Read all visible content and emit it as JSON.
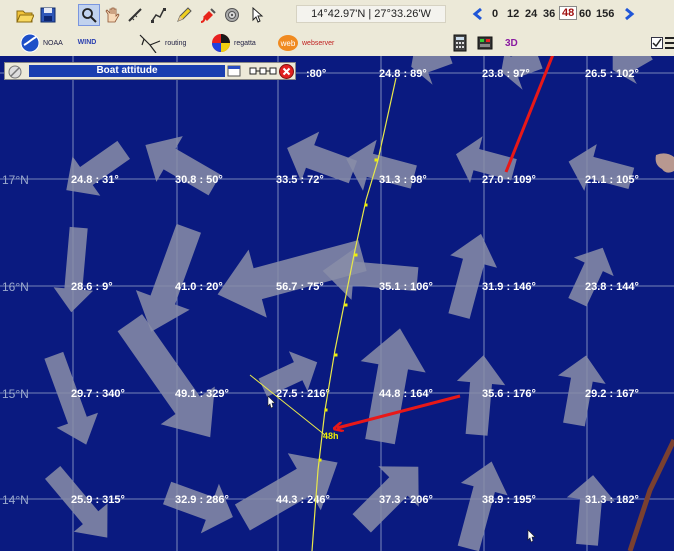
{
  "toolbar": {
    "coords": "14°42.97'N | 27°33.26'W",
    "hours": [
      "0",
      "12",
      "24",
      "36",
      "48",
      "60",
      "156"
    ],
    "selected_hour": "48",
    "icons": [
      "open-folder-icon",
      "save-disk-icon",
      "zoom-icon",
      "pan-hand-icon",
      "measure-icon",
      "route-icon",
      "pencil-icon",
      "paint-icon",
      "target-icon",
      "pointer-icon"
    ]
  },
  "toolbar2": {
    "noaa": "NOAA",
    "wind": "WIND",
    "routing": "routing",
    "regatta": "regatta",
    "webserver": "webserver",
    "three_d": "3D"
  },
  "panel": {
    "title": "Boat attitude"
  },
  "map": {
    "lat_labels": [
      "17°N",
      "16°N",
      "15°N",
      "14°N"
    ],
    "wind_labels": [
      [
        "",
        ":80°",
        "24.8 : 89°",
        "23.8 : 97°",
        "26.5 : 102°"
      ],
      [
        "24.8 : 31°",
        "30.8 : 50°",
        "33.5 : 72°",
        "31.3 : 98°",
        "27.0 : 109°",
        "21.1 : 105°"
      ],
      [
        "28.6 : 9°",
        "41.0 : 20°",
        "56.7 : 75°",
        "35.1 : 106°",
        "31.9 : 146°",
        "23.8 : 144°"
      ],
      [
        "29.7 : 340°",
        "49.1 : 329°",
        "27.5 : 216°",
        "44.8 : 164°",
        "35.6 : 176°",
        "29.2 : 167°"
      ],
      [
        "25.9 : 315°",
        "32.9 : 286°",
        "44.3 : 246°",
        "37.3 : 206°",
        "38.9 : 195°",
        "31.3 : 182°"
      ]
    ],
    "boat_label": "48h"
  }
}
